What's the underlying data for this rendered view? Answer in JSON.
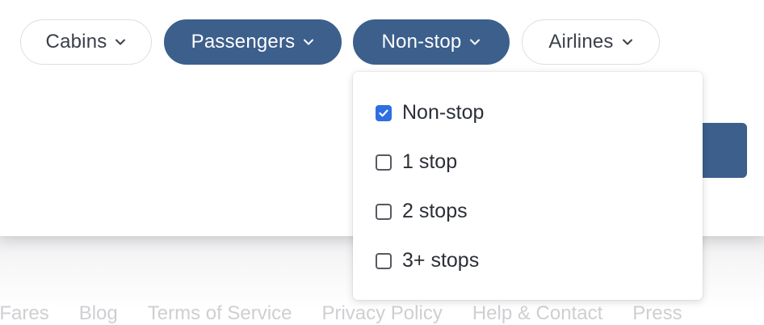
{
  "filters": {
    "cabins": {
      "label": "Cabins"
    },
    "passengers": {
      "label": "Passengers"
    },
    "nonstop": {
      "label": "Non-stop"
    },
    "airlines": {
      "label": "Airlines"
    }
  },
  "stops_dropdown": {
    "options": [
      {
        "label": "Non-stop",
        "checked": true
      },
      {
        "label": "1 stop",
        "checked": false
      },
      {
        "label": "2 stops",
        "checked": false
      },
      {
        "label": "3+ stops",
        "checked": false
      }
    ]
  },
  "footer": {
    "links": [
      "rdFares",
      "Blog",
      "Terms of Service",
      "Privacy Policy",
      "Help & Contact",
      "Press"
    ]
  },
  "colors": {
    "accent": "#3c5f8c",
    "checkbox_checked": "#2f6fe0"
  },
  "icons": {
    "pill_chevron": "chevron-down-icon",
    "checkmark": "checkmark-icon"
  }
}
